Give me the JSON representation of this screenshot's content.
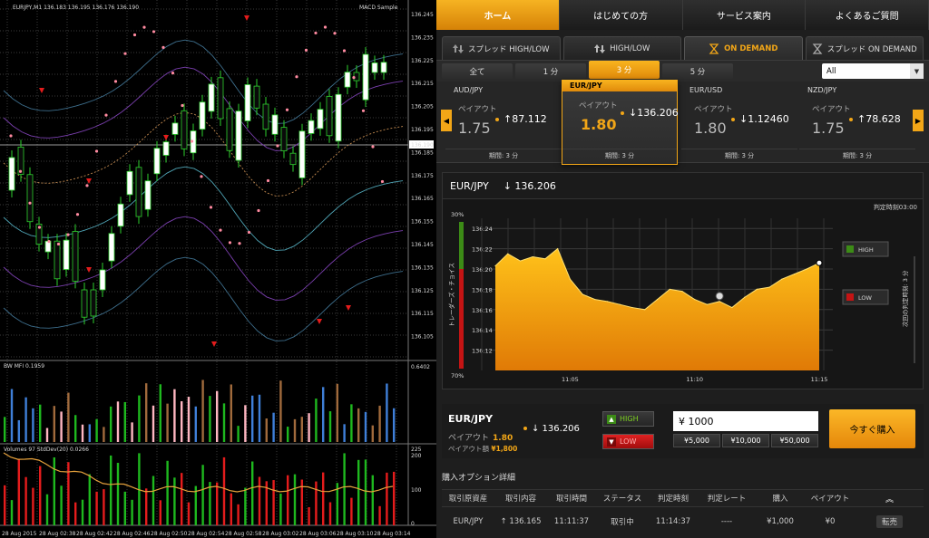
{
  "mt4": {
    "header": "EURJPY,M1  136.183 136.195 136.176 136.190",
    "expert": "MACD Sample",
    "price_scale": [
      "136.245",
      "136.235",
      "136.225",
      "136.215",
      "136.205",
      "136.195",
      "136.185",
      "136.175",
      "136.165",
      "136.155",
      "136.145",
      "136.135",
      "136.125",
      "136.115",
      "136.105"
    ],
    "current_price": "136.190",
    "mfi_label": "BW MFI 0.1959",
    "mfi_scale": "0.6402",
    "vol_label": "Volumes 97  StdDev(20) 0.0266",
    "vol_scale": [
      "225",
      "200",
      "100",
      "0"
    ],
    "time_labels": [
      "28 Aug 2015",
      "28 Aug 02:38",
      "28 Aug 02:42",
      "28 Aug 02:46",
      "28 Aug 02:50",
      "28 Aug 02:54",
      "28 Aug 02:58",
      "28 Aug 03:02",
      "28 Aug 03:06",
      "28 Aug 03:10",
      "28 Aug 03:14"
    ]
  },
  "nav": {
    "tabs": [
      {
        "label": "ホーム",
        "active": true
      },
      {
        "label": "はじめての方",
        "active": false
      },
      {
        "label": "サービス案内",
        "active": false
      },
      {
        "label": "よくあるご質問",
        "active": false
      }
    ]
  },
  "modes": [
    {
      "label": "スプレッド HIGH/LOW",
      "icon": "spread-updown-icon",
      "active": false
    },
    {
      "label": "HIGH/LOW",
      "icon": "updown-arrows-icon",
      "active": false
    },
    {
      "label": "ON DEMAND",
      "icon": "hourglass-icon",
      "active": true
    },
    {
      "label": "スプレッド ON DEMAND",
      "icon": "hourglass-icon",
      "active": false
    }
  ],
  "periods": [
    {
      "label": "全て",
      "active": false
    },
    {
      "label": "1 分",
      "active": false
    },
    {
      "label": "3 分",
      "active": true
    },
    {
      "label": "5 分",
      "active": false
    }
  ],
  "filter_select": "All",
  "pairs": [
    {
      "name": "AUD/JPY",
      "payout_label": "ペイアウト",
      "payout": "1.75",
      "rate": "↑87.112",
      "period": "期間: 3 分",
      "active": false
    },
    {
      "name": "EUR/JPY",
      "payout_label": "ペイアウト",
      "payout": "1.80",
      "rate": "↓136.206",
      "period": "期間: 3 分",
      "active": true
    },
    {
      "name": "EUR/USD",
      "payout_label": "ペイアウト",
      "payout": "1.80",
      "rate": "↓1.12460",
      "period": "期間: 3 分",
      "active": false
    },
    {
      "name": "NZD/JPY",
      "payout_label": "ペイアウト",
      "payout": "1.75",
      "rate": "↑78.628",
      "period": "期間: 3 分",
      "active": false
    }
  ],
  "chart": {
    "pair": "EUR/JPY",
    "rate": "↓ 136.206",
    "judge_label": "判定時刻03:00",
    "sentiment_top": "30%",
    "sentiment_bottom": "70%",
    "sentiment_label": "トレーダーズ・チョイス",
    "high_label": "HIGH",
    "low_label": "LOW",
    "countdown_label": "次回の判定時刻: 3 分",
    "colors": {
      "area_top": "#ffc21a",
      "area_bottom": "#e07a06",
      "accent": "#f2a617"
    }
  },
  "chart_data": {
    "type": "area",
    "title": "",
    "xlabel": "",
    "ylabel": "",
    "ylim": [
      136.1,
      136.25
    ],
    "yticks": [
      "136.24",
      "136.22",
      "136.20",
      "136.18",
      "136.16",
      "136.14",
      "136.12"
    ],
    "xticks": [
      "11:05",
      "11:10",
      "11:15"
    ],
    "x": [
      "11:02:00",
      "11:02:30",
      "11:03:00",
      "11:03:30",
      "11:04:00",
      "11:04:30",
      "11:05:00",
      "11:05:30",
      "11:06:00",
      "11:06:30",
      "11:07:00",
      "11:07:30",
      "11:08:00",
      "11:08:30",
      "11:09:00",
      "11:09:30",
      "11:10:00",
      "11:10:30",
      "11:11:00",
      "11:11:30",
      "11:12:00",
      "11:12:30",
      "11:13:00",
      "11:13:30",
      "11:14:00",
      "11:14:30",
      "11:15:00"
    ],
    "values": [
      136.203,
      136.215,
      136.208,
      136.212,
      136.21,
      136.22,
      136.19,
      136.175,
      136.17,
      136.168,
      136.165,
      136.162,
      136.16,
      136.17,
      136.18,
      136.178,
      136.17,
      136.165,
      136.168,
      136.162,
      136.172,
      136.18,
      136.182,
      136.19,
      136.195,
      136.2,
      136.206
    ],
    "grid": true
  },
  "buy": {
    "pair": "EUR/JPY",
    "rate": "↓ 136.206",
    "payout_label": "ペイアウト",
    "payout": "1.80",
    "payout_amount_label": "ペイアウト額",
    "payout_amount": "¥1,800",
    "high_label": "HIGH",
    "low_label": "LOW",
    "amount": "¥ 1000",
    "quick": [
      "¥5,000",
      "¥10,000",
      "¥50,000"
    ],
    "buy_now": "今すぐ購入"
  },
  "details": {
    "title": "購入オプション詳細",
    "columns": [
      "取引原資産",
      "取引内容",
      "取引時間",
      "ステータス",
      "判定時刻",
      "判定レート",
      "購入",
      "ペイアウト"
    ],
    "rows": [
      [
        "EUR/JPY",
        "↑ 136.165",
        "11:11:37",
        "取引中",
        "11:14:37",
        "----",
        "¥1,000",
        "¥0"
      ]
    ],
    "sell_label": "転売"
  }
}
